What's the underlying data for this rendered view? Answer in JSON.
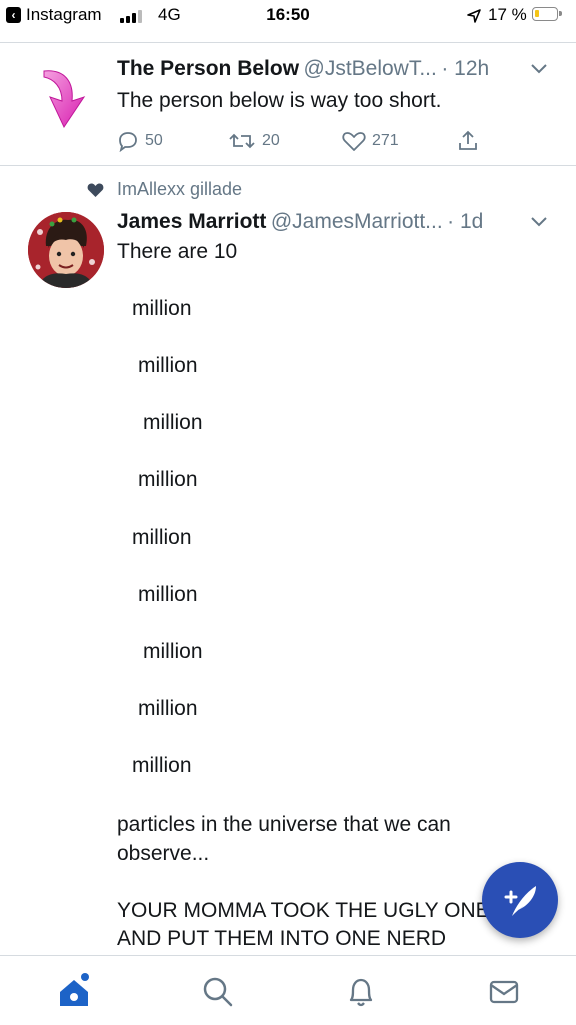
{
  "status_bar": {
    "app": "Instagram",
    "network": "4G",
    "time": "16:50",
    "battery": "17 %"
  },
  "tweets": [
    {
      "name": "The Person Below",
      "handle": "@JstBelowT...",
      "time": "· 12h",
      "text": "The person below is way too short.",
      "replies": "50",
      "retweets": "20",
      "likes": "271"
    },
    {
      "context": "ImAllexx gillade",
      "name": "James Marriott",
      "handle": "@JamesMarriott...",
      "time": "· 1d",
      "lines": [
        "There are 10",
        "million",
        "million",
        "million",
        "million",
        "million",
        "million",
        "million",
        "million",
        "million",
        "particles in the universe that we can",
        "observe...",
        "YOUR MOMMA TOOK THE UGLY ONES",
        "AND PUT THEM INTO ONE NERD"
      ]
    }
  ],
  "icons": {
    "back": "back-chevron-icon",
    "location": "location-arrow-icon",
    "compose": "compose-tweet-icon",
    "home": "home-icon",
    "search": "search-icon",
    "notifications": "bell-icon",
    "messages": "mail-icon"
  },
  "colors": {
    "accent": "#1da1f2",
    "fab": "#2a4fb5",
    "text_secondary": "#657786",
    "arrow_pink": "#e040c0"
  }
}
